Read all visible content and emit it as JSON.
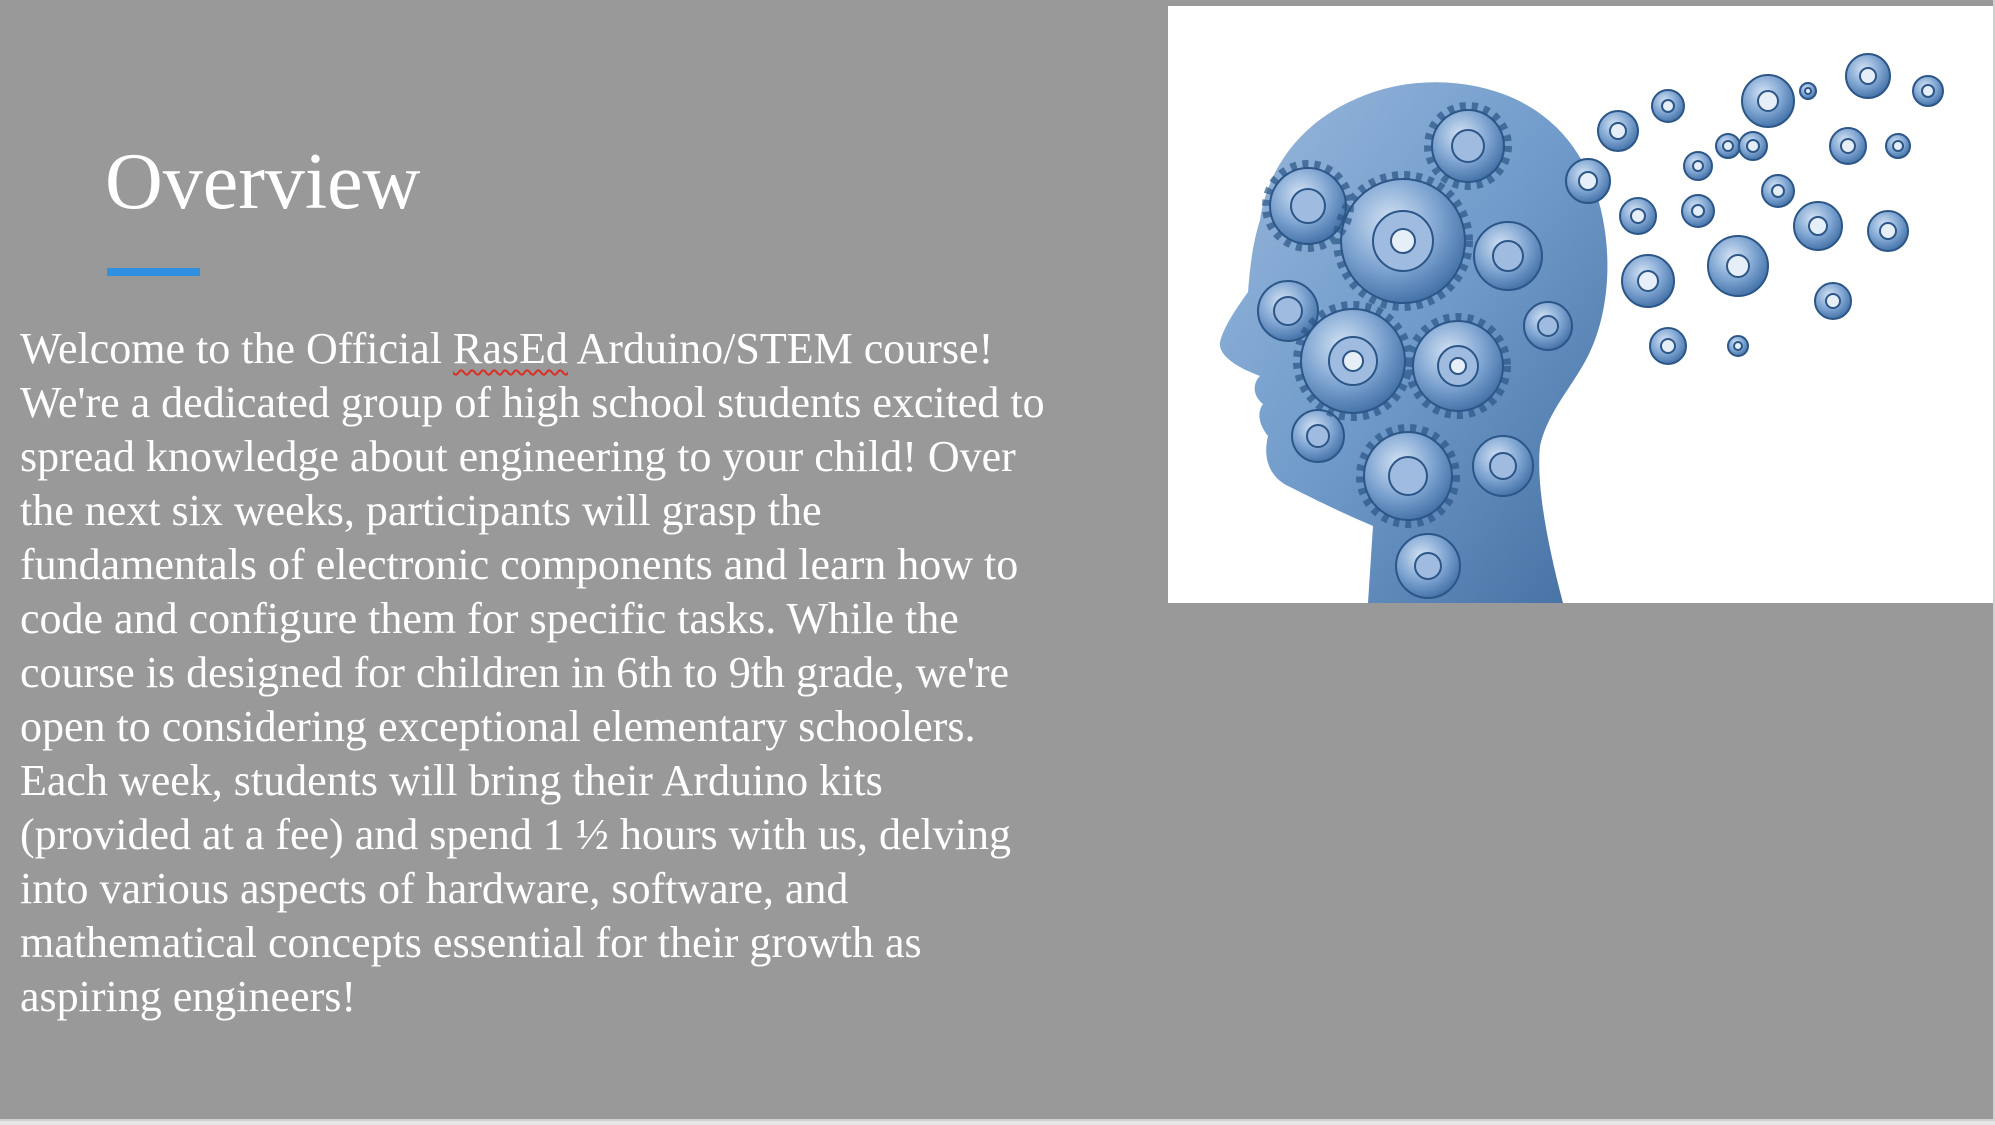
{
  "slide": {
    "title": "Overview",
    "accent_color": "#2f8fe0",
    "background_color": "#999999",
    "body_lines": {
      "l1a": "Welcome to the Official ",
      "l1b": "RasEd",
      "l1c": " Arduino/STEM course!",
      "l2": "We're a dedicated group of high school students excited to",
      "l3": "spread knowledge about engineering to your child! Over",
      "l4": "the next six weeks, participants will grasp the",
      "l5": "fundamentals of electronic components and learn how to",
      "l6": "code and configure them for specific tasks. While the",
      "l7": "course is designed for children in 6th to 9th grade, we're",
      "l8": "open to considering exceptional elementary schoolers.",
      "l9": "Each week, students will bring their Arduino kits",
      "l10": "(provided at a fee) and spend 1 ½ hours with us, delving",
      "l11": "into various aspects of hardware, software, and",
      "l12": "mathematical concepts essential for their growth as",
      "l13": "aspiring engineers!"
    },
    "image": {
      "icon": "gear-head-icon",
      "gear_color": "#4f7fb8"
    }
  }
}
